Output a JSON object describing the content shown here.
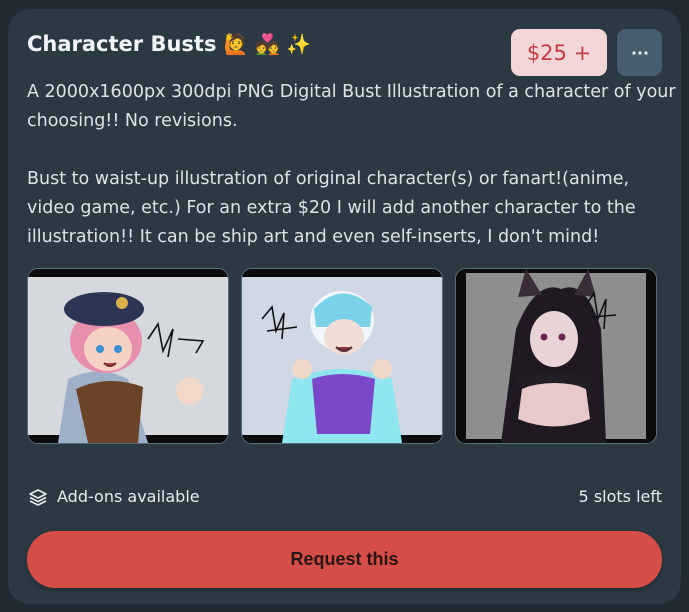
{
  "card": {
    "title": "Character Busts",
    "title_emojis": "🙋 💑 ✨",
    "price": "$25 +",
    "more_icon": "ellipsis-icon",
    "description": [
      "A 2000x1600px 300dpi PNG Digital Bust Illustration of a character of your choosing!! No revisions.",
      "Bust to waist-up illustration of original character(s) or fanart!(anime, video game, etc.) For an extra $20 I will add another character to the illustration!! It can be ship art and even self-inserts, I don't mind!"
    ],
    "addons_label": "Add-ons available",
    "addons_icon": "layers-icon",
    "slots": "5 slots left",
    "cta": "Request this"
  },
  "colors": {
    "card_bg": "#2b3942",
    "price_bg": "#f3d6d8",
    "price_text": "#c43b44",
    "cta_bg": "#d54d47"
  }
}
